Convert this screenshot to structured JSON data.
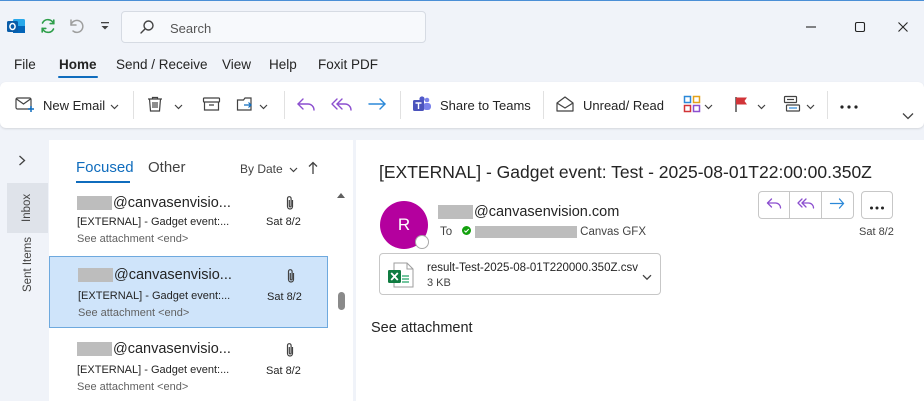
{
  "titlebar": {
    "search_placeholder": "Search"
  },
  "menu": {
    "tabs": [
      "File",
      "Home",
      "Send / Receive",
      "View",
      "Help",
      "Foxit PDF"
    ],
    "active": "Home"
  },
  "ribbon": {
    "new_email": "New Email",
    "share_to_teams": "Share to Teams",
    "unread_read": "Unread/ Read"
  },
  "rail": {
    "inbox": "Inbox",
    "sent": "Sent Items"
  },
  "list": {
    "focused": "Focused",
    "other": "Other",
    "sort": "By Date",
    "messages": [
      {
        "sender": "@canvasenvisio...",
        "subject": "[EXTERNAL] - Gadget event:...",
        "preview": "See attachment <end>",
        "date": "Sat 8/2",
        "selected": false
      },
      {
        "sender": "@canvasenvisio...",
        "subject": "[EXTERNAL] - Gadget event:...",
        "preview": "See attachment <end>",
        "date": "Sat 8/2",
        "selected": true
      },
      {
        "sender": "@canvasenvisio...",
        "subject": "[EXTERNAL] - Gadget event:...",
        "preview": "See attachment <end>",
        "date": "Sat 8/2",
        "selected": false
      }
    ]
  },
  "reading": {
    "subject": "[EXTERNAL] - Gadget event: Test - 2025-08-01T22:00:00.350Z",
    "avatar_initial": "R",
    "avatar_color": "#b4009e",
    "from": "@canvasenvision.com",
    "to_label": "To",
    "to_name": "Canvas GFX",
    "date": "Sat 8/2",
    "attachment": {
      "name": "result-Test-2025-08-01T220000.350Z.csv",
      "size": "3 KB"
    },
    "body": "See attachment"
  },
  "colors": {
    "accent": "#0f6cbd",
    "selected_bg": "#cfe4fa",
    "background": "#f0f3f9"
  }
}
